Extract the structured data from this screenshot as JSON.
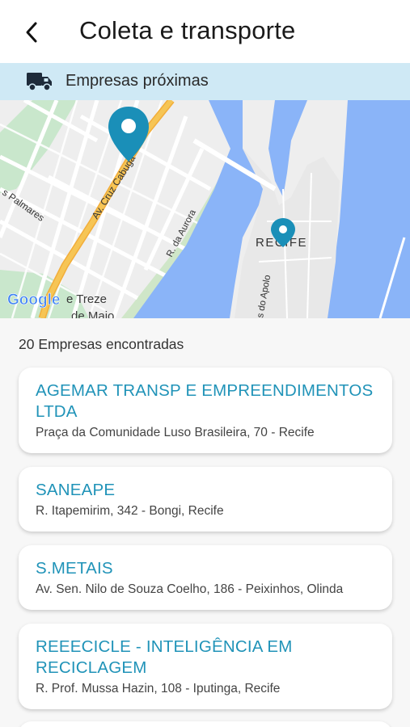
{
  "header": {
    "title": "Coleta e transporte",
    "back_icon": "chevron-left-icon"
  },
  "banner": {
    "icon": "truck-icon",
    "text": "Empresas próximas"
  },
  "map": {
    "labels": {
      "cruz_cabuga": "Av. Cruz Cabugá",
      "palmares": "s Palmares",
      "aurora": "R. da Aurora",
      "recife": "RECIFE",
      "apolo": "s do Apolo",
      "treze": "e Treze",
      "maio": "de Maio",
      "google": "Google"
    },
    "colors": {
      "water": "#8ab4f8",
      "land": "#eeeeee",
      "park": "#c9e7cc",
      "highway": "#f6c555",
      "pin": "#1a8fb8"
    }
  },
  "results": {
    "count_text": "20 Empresas encontradas"
  },
  "companies": [
    {
      "name": "AGEMAR TRANSP E EMPREENDIMENTOS LTDA",
      "address": "Praça da Comunidade Luso Brasileira, 70 - Recife"
    },
    {
      "name": "SANEAPE",
      "address": "R. Itapemirim, 342 - Bongi, Recife"
    },
    {
      "name": "S.METAIS",
      "address": "Av. Sen. Nilo de Souza Coelho, 186 - Peixinhos, Olinda"
    },
    {
      "name": "REEECICLE - INTELIGÊNCIA EM RECICLAGEM",
      "address": "R. Prof. Mussa Hazin, 108 - Iputinga, Recife"
    }
  ]
}
